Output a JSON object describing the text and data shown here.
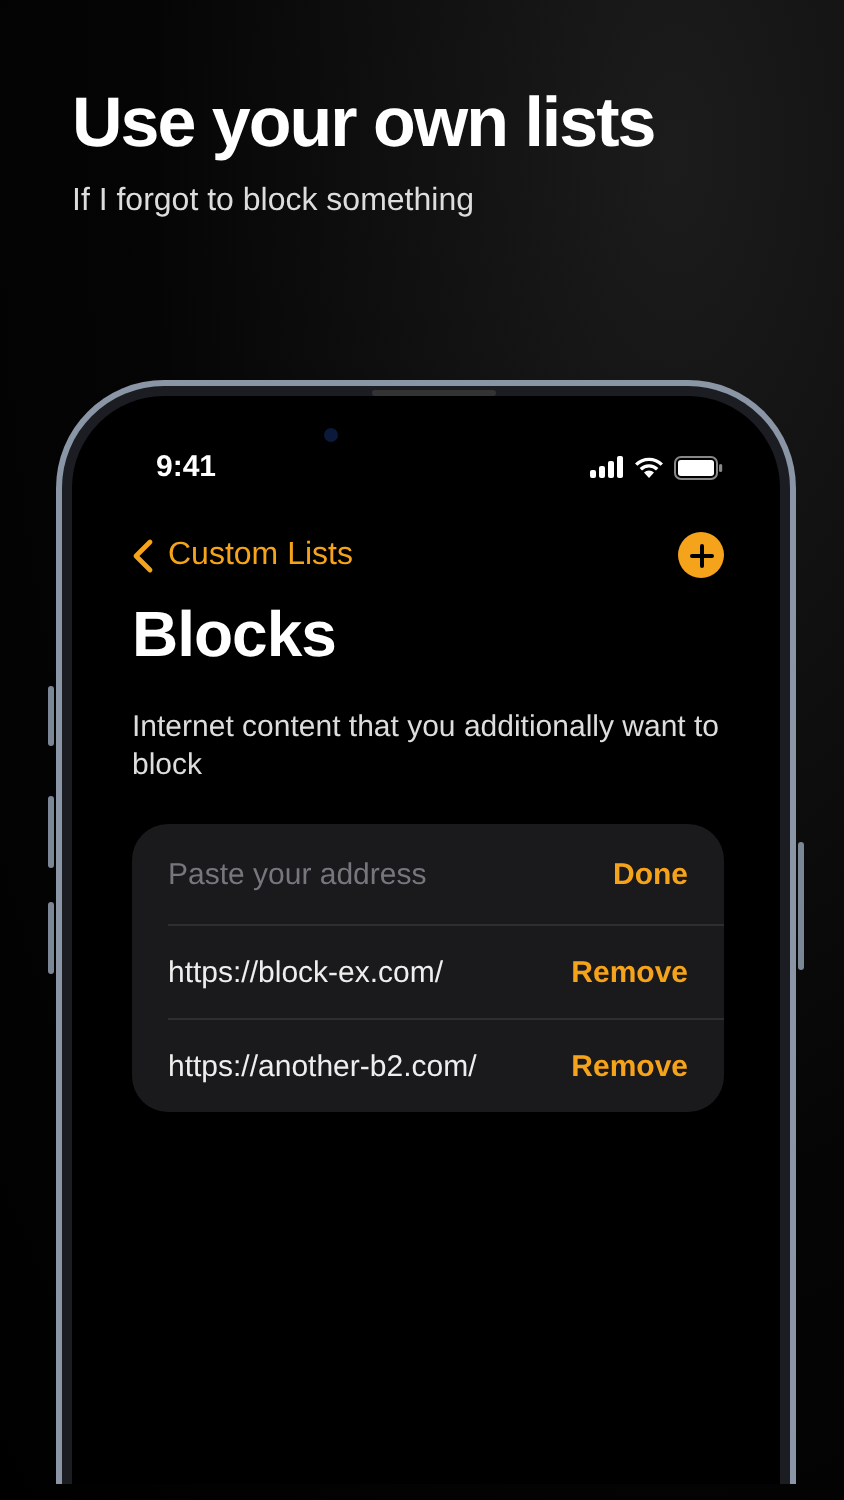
{
  "headline": "Use your own lists",
  "subtitle": "If I forgot to block something",
  "status_bar": {
    "time": "9:41"
  },
  "nav": {
    "back_label": "Custom Lists"
  },
  "title": "Blocks",
  "description": "Internet content that you additionally want to block",
  "entry": {
    "placeholder": "Paste your address",
    "action": "Done"
  },
  "items": [
    {
      "url": "https://block-ex.com/",
      "action": "Remove"
    },
    {
      "url": "https://another-b2.com/",
      "action": "Remove"
    }
  ]
}
